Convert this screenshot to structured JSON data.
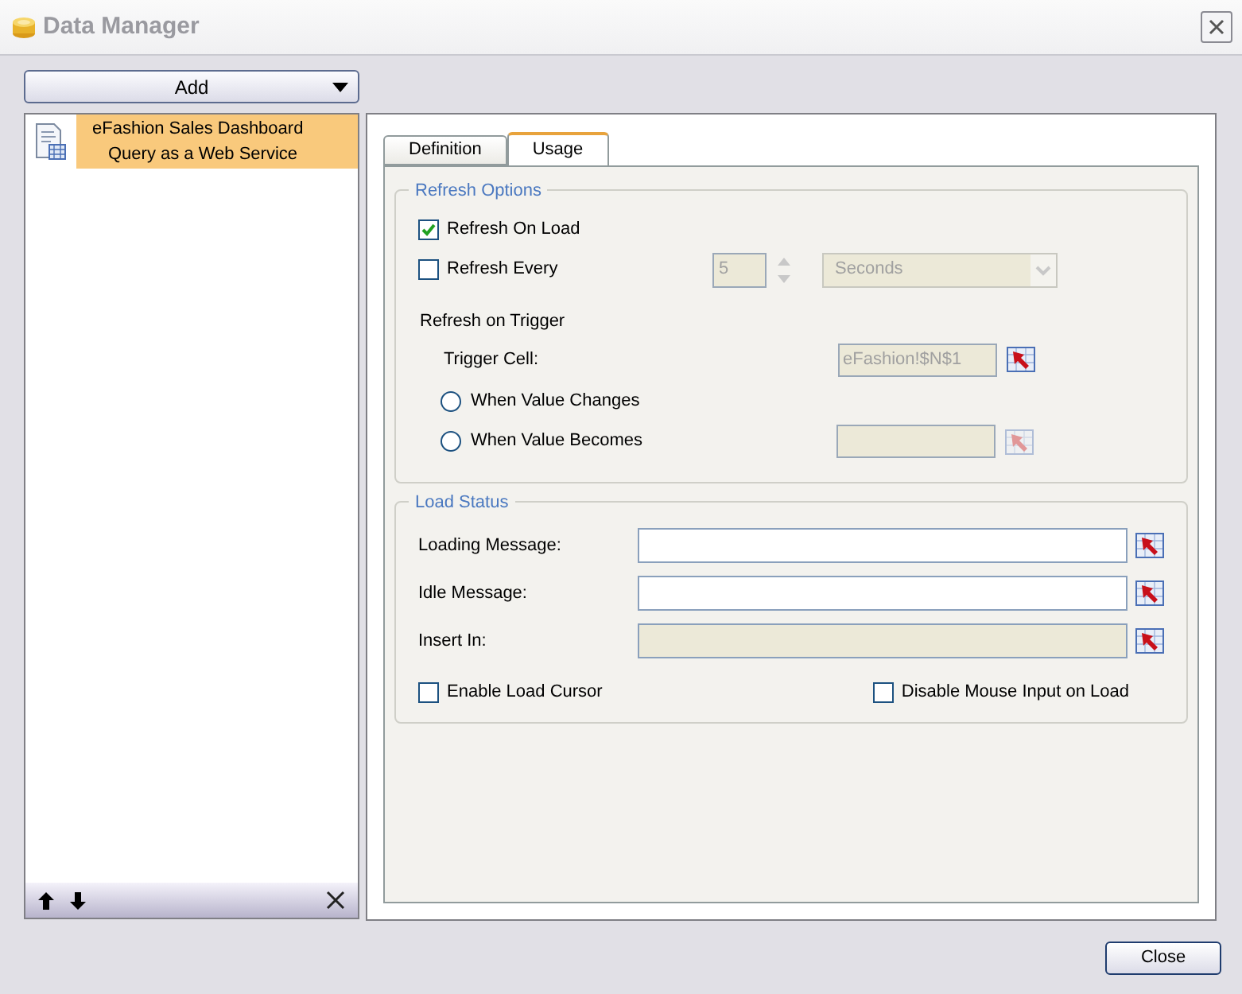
{
  "window": {
    "title": "Data Manager"
  },
  "add_button": {
    "label": "Add"
  },
  "connections": [
    {
      "lines": [
        "eFashion Sales Dashboard",
        "Query as a Web Service"
      ],
      "selected": true
    }
  ],
  "tabs": [
    {
      "label": "Definition",
      "selected": false
    },
    {
      "label": "Usage",
      "selected": true
    }
  ],
  "refresh_options": {
    "title": "Refresh Options",
    "refresh_on_load": {
      "label": "Refresh On Load",
      "checked": true
    },
    "refresh_every": {
      "label": "Refresh Every",
      "checked": false,
      "interval": "5",
      "unit": "Seconds",
      "disabled": true
    },
    "trigger_heading": "Refresh on Trigger",
    "trigger_cell": {
      "label": "Trigger Cell:",
      "value": "eFashion!$N$1",
      "disabled": true
    },
    "radios": [
      {
        "label": "When Value Changes",
        "selected": false
      },
      {
        "label": "When Value Becomes",
        "selected": false,
        "disabled": true
      }
    ]
  },
  "load_status": {
    "title": "Load Status",
    "fields": [
      {
        "label": "Loading Message:",
        "disabled": false
      },
      {
        "label": "Idle Message:",
        "disabled": false
      },
      {
        "label": "Insert In:",
        "disabled": true
      }
    ],
    "checkboxes": [
      {
        "label": "Enable Load Cursor",
        "checked": false
      },
      {
        "label": "Disable Mouse Input on Load",
        "checked": false
      }
    ]
  },
  "close_button": {
    "label": "Close"
  }
}
